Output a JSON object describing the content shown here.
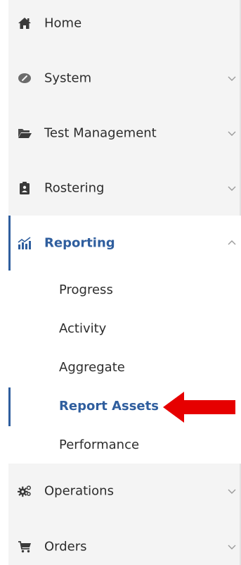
{
  "sidebar": {
    "items": [
      {
        "label": "Home",
        "icon": "home-icon"
      },
      {
        "label": "System",
        "icon": "gauge-icon"
      },
      {
        "label": "Test Management",
        "icon": "folder-icon"
      },
      {
        "label": "Rostering",
        "icon": "clipboard-icon"
      },
      {
        "label": "Reporting",
        "icon": "bar-chart-icon"
      },
      {
        "label": "Operations",
        "icon": "gears-icon"
      },
      {
        "label": "Orders",
        "icon": "cart-icon"
      }
    ],
    "reporting_submenu": [
      {
        "label": "Progress"
      },
      {
        "label": "Activity"
      },
      {
        "label": "Aggregate"
      },
      {
        "label": "Report Assets",
        "active": true
      },
      {
        "label": "Performance"
      }
    ]
  },
  "colors": {
    "accent": "#2f5e9e",
    "arrow": "#e60000",
    "sidebar_bg": "#f4f4f4",
    "text": "#2d2d2d"
  }
}
